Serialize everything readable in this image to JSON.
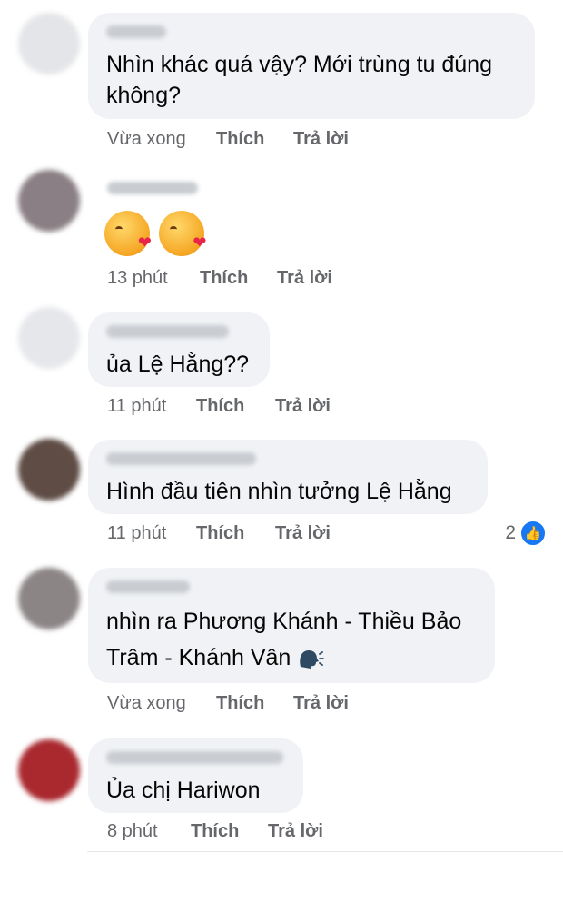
{
  "comments": [
    {
      "text_lines": [
        "Nhìn khác quá vậy? Mới trùng tu đúng",
        "không?"
      ],
      "time": "Vừa xong",
      "like": "Thích",
      "reply": "Trả lời"
    },
    {
      "text_lines": [],
      "emojis": [
        "kissing-face-with-heart",
        "kissing-face-with-heart"
      ],
      "time": "13 phút",
      "like": "Thích",
      "reply": "Trả lời"
    },
    {
      "text_lines": [
        "ủa Lệ Hằng??"
      ],
      "time": "11 phút",
      "like": "Thích",
      "reply": "Trả lời"
    },
    {
      "text_lines": [
        "Hình đầu tiên nhìn tưởng Lệ Hằng"
      ],
      "time": "11 phút",
      "like": "Thích",
      "reply": "Trả lời",
      "reaction_count": "2"
    },
    {
      "text_lines": [
        "nhìn ra Phương Khánh - Thiều Bảo",
        "Trâm - Khánh Vân"
      ],
      "emoji_after": "speaking-head",
      "time": "Vừa xong",
      "like": "Thích",
      "reply": "Trả lời"
    },
    {
      "text_lines": [
        "Ủa chị Hariwon"
      ],
      "time": "8 phút",
      "like": "Thích",
      "reply": "Trả lời"
    }
  ],
  "colors": {
    "bubble": "#f0f2f5",
    "meta": "#65676b",
    "like_badge": "#1877f2"
  }
}
